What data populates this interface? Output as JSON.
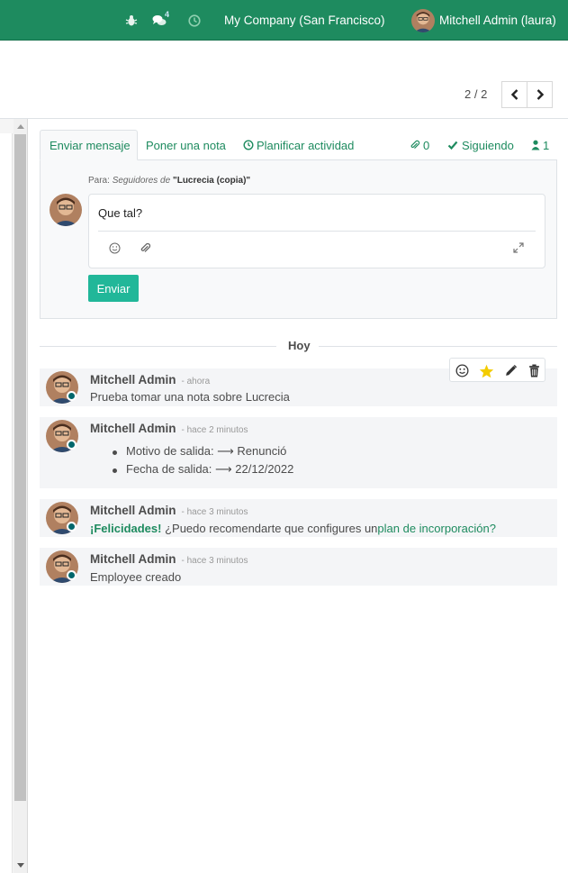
{
  "navbar": {
    "chat_count": "4",
    "company": "My Company (San Francisco)",
    "user_name": "Mitchell Admin (laura)",
    "icons": [
      "bug-icon",
      "chat-icon",
      "clock-icon"
    ]
  },
  "pager": {
    "value": "2 / 2"
  },
  "chatter": {
    "tabs": {
      "send_message": "Enviar mensaje",
      "log_note": "Poner una nota",
      "schedule_activity": "Planificar actividad",
      "attachments_count": "0",
      "following": "Siguiendo",
      "followers_count": "1"
    },
    "composer": {
      "to_label": "Para:",
      "to_followers": "Seguidores de",
      "to_record": "\"Lucrecia (copia)\"",
      "text": "Que tal?",
      "send_label": "Enviar"
    },
    "date_separator": "Hoy",
    "messages": [
      {
        "author": "Mitchell Admin",
        "when": "- ahora",
        "body": "Prueba tomar una nota sobre Lucrecia"
      },
      {
        "author": "Mitchell Admin",
        "when": "- hace 2 minutos",
        "tracking": [
          "Motivo de salida: ⟶ Renunció",
          "Fecha de salida: ⟶ 22/12/2022"
        ]
      },
      {
        "author": "Mitchell Admin",
        "when": "- hace 3 minutos",
        "body_bold": "¡Felicidades!",
        "body": " ¿Puedo recomendarte que configures un",
        "link": "plan de incorporación?"
      },
      {
        "author": "Mitchell Admin",
        "when": "- hace 3 minutos",
        "body": "Employee creado"
      }
    ]
  },
  "colors": {
    "brand": "#1e8b5f",
    "send_button": "#21b799",
    "star": "#f3cc00"
  }
}
